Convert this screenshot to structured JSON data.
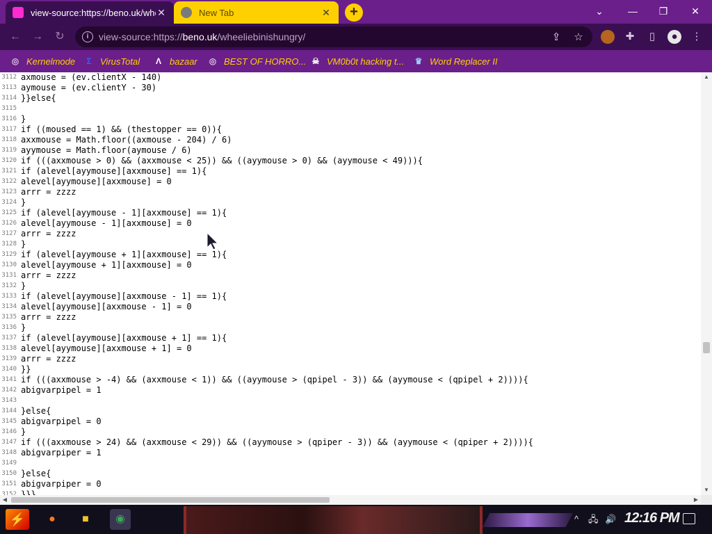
{
  "browser": {
    "tabs": [
      {
        "title": "view-source:https://beno.uk/wheeliebinishungry/",
        "active": true,
        "favicon": "magenta-square-icon"
      },
      {
        "title": "New Tab",
        "active": false,
        "favicon": "chrome-icon"
      }
    ],
    "new_tab_symbol": "+",
    "window_controls": {
      "minimize": "⌄",
      "min": "—",
      "restore": "❐",
      "close": "✕"
    },
    "address": {
      "prefix": "view-source:https://",
      "host": "beno.uk",
      "path": "/wheeliebinishungry/"
    },
    "bookmarks": [
      {
        "label": "Kernelmode",
        "icon": "globe-icon"
      },
      {
        "label": "VirusTotal",
        "icon": "virustotal-icon"
      },
      {
        "label": "bazaar",
        "icon": "bazaar-icon"
      },
      {
        "label": "BEST OF HORRO...",
        "icon": "globe-icon"
      },
      {
        "label": "VM0b0t hacking t...",
        "icon": "skull-icon"
      },
      {
        "label": "Word Replacer II",
        "icon": "word-replacer-icon"
      }
    ]
  },
  "source": {
    "lines": [
      {
        "n": "3112",
        "text": "axmouse = (ev.clientX - 140)"
      },
      {
        "n": "3113",
        "text": "aymouse = (ev.clientY - 30)"
      },
      {
        "n": "3114",
        "text": "}}else{"
      },
      {
        "n": "3115",
        "text": ""
      },
      {
        "n": "3116",
        "text": "}"
      },
      {
        "n": "3117",
        "text": "if ((moused == 1) && (thestopper == 0)){"
      },
      {
        "n": "3118",
        "text": "axxmouse = Math.floor((axmouse - 204) / 6)"
      },
      {
        "n": "3119",
        "text": "ayymouse = Math.floor(aymouse / 6)"
      },
      {
        "n": "3120",
        "text": "if (((axxmouse > 0) && (axxmouse < 25)) && ((ayymouse > 0) && (ayymouse < 49))){"
      },
      {
        "n": "3121",
        "text": "if (alevel[ayymouse][axxmouse] == 1){"
      },
      {
        "n": "3122",
        "text": "alevel[ayymouse][axxmouse] = 0"
      },
      {
        "n": "3123",
        "text": "arrr = zzzz"
      },
      {
        "n": "3124",
        "text": "}"
      },
      {
        "n": "3125",
        "text": "if (alevel[ayymouse - 1][axxmouse] == 1){"
      },
      {
        "n": "3126",
        "text": "alevel[ayymouse - 1][axxmouse] = 0"
      },
      {
        "n": "3127",
        "text": "arrr = zzzz"
      },
      {
        "n": "3128",
        "text": "}"
      },
      {
        "n": "3129",
        "text": "if (alevel[ayymouse + 1][axxmouse] == 1){"
      },
      {
        "n": "3130",
        "text": "alevel[ayymouse + 1][axxmouse] = 0"
      },
      {
        "n": "3131",
        "text": "arrr = zzzz"
      },
      {
        "n": "3132",
        "text": "}"
      },
      {
        "n": "3133",
        "text": "if (alevel[ayymouse][axxmouse - 1] == 1){"
      },
      {
        "n": "3134",
        "text": "alevel[ayymouse][axxmouse - 1] = 0"
      },
      {
        "n": "3135",
        "text": "arrr = zzzz"
      },
      {
        "n": "3136",
        "text": "}"
      },
      {
        "n": "3137",
        "text": "if (alevel[ayymouse][axxmouse + 1] == 1){"
      },
      {
        "n": "3138",
        "text": "alevel[ayymouse][axxmouse + 1] = 0"
      },
      {
        "n": "3139",
        "text": "arrr = zzzz"
      },
      {
        "n": "3140",
        "text": "}}"
      },
      {
        "n": "3141",
        "text": "if (((axxmouse > -4) && (axxmouse < 1)) && ((ayymouse > (qpipel - 3)) && (ayymouse < (qpipel + 2)))){"
      },
      {
        "n": "3142",
        "text": "abigvarpipel = 1"
      },
      {
        "n": "3143",
        "text": ""
      },
      {
        "n": "3144",
        "text": "}else{"
      },
      {
        "n": "3145",
        "text": "abigvarpipel = 0"
      },
      {
        "n": "3146",
        "text": "}"
      },
      {
        "n": "3147",
        "text": "if (((axxmouse > 24) && (axxmouse < 29)) && ((ayymouse > (qpiper - 3)) && (ayymouse < (qpiper + 2)))){"
      },
      {
        "n": "3148",
        "text": "abigvarpiper = 1"
      },
      {
        "n": "3149",
        "text": ""
      },
      {
        "n": "3150",
        "text": "}else{"
      },
      {
        "n": "3151",
        "text": "abigvarpiper = 0"
      },
      {
        "n": "3152",
        "text": "}}}"
      }
    ]
  },
  "taskbar": {
    "apps": [
      {
        "name": "firefox-icon",
        "glyph": "●",
        "color": "#ff7a1a"
      },
      {
        "name": "file-explorer-icon",
        "glyph": "■",
        "color": "#f2c230"
      },
      {
        "name": "chrome-icon",
        "glyph": "◉",
        "color": "#3aa757"
      }
    ],
    "tray": {
      "chevron": "^",
      "network": "🖧",
      "volume": "🔊"
    },
    "clock": "12:16 PM"
  },
  "colors": {
    "accent_purple": "#6b1f8a",
    "dark_purple": "#3a0f52",
    "tab_yellow": "#ffd000",
    "bookmark_text": "#ffd000"
  }
}
